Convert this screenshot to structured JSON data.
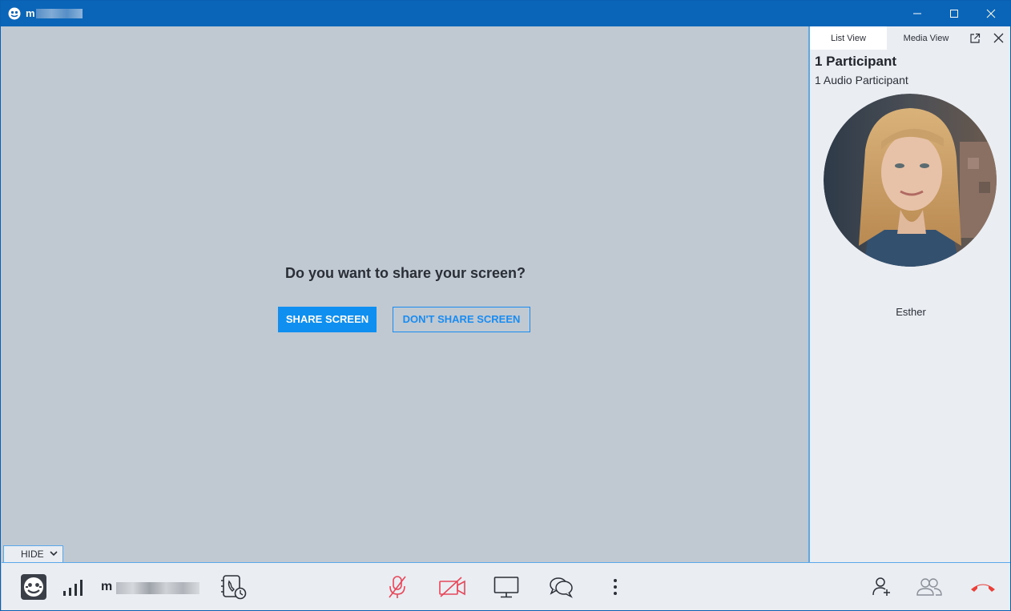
{
  "window": {
    "title": "m"
  },
  "dialog": {
    "question": "Do you want to share your screen?",
    "share_label": "SHARE SCREEN",
    "dont_share_label": "DON'T SHARE SCREEN"
  },
  "panel": {
    "tabs": [
      {
        "label": "List View",
        "active": true
      },
      {
        "label": "Media View",
        "active": false
      }
    ],
    "participant_count": "1 Participant",
    "audio_participants": "1 Audio Participant",
    "participants": [
      {
        "name": "Esther"
      }
    ]
  },
  "bottom": {
    "hide_label": "HIDE",
    "user_label": "m"
  },
  "icons": {
    "app": "app-logo-icon",
    "minimize": "minimize-icon",
    "maximize": "maximize-icon",
    "close": "close-icon",
    "popout": "popout-icon",
    "close_panel": "close-panel-icon",
    "chevron": "chevron-down-icon",
    "avatar_self": "self-avatar-icon",
    "signal": "signal-strength-icon",
    "dialpad": "dial-phone-icon",
    "mic": "microphone-muted-icon",
    "camera": "camera-off-icon",
    "screen": "screen-share-icon",
    "chat": "chat-icon",
    "more": "more-vertical-icon",
    "add_user": "add-participant-icon",
    "participants": "participants-icon",
    "hangup": "hang-up-icon"
  },
  "colors": {
    "titlebar": "#0a64b8",
    "accent": "#0f8ff0",
    "stage": "#c0c8d2",
    "panel": "#eaedf2",
    "muted_red": "#e5485b",
    "hangup_red": "#e8403a"
  }
}
